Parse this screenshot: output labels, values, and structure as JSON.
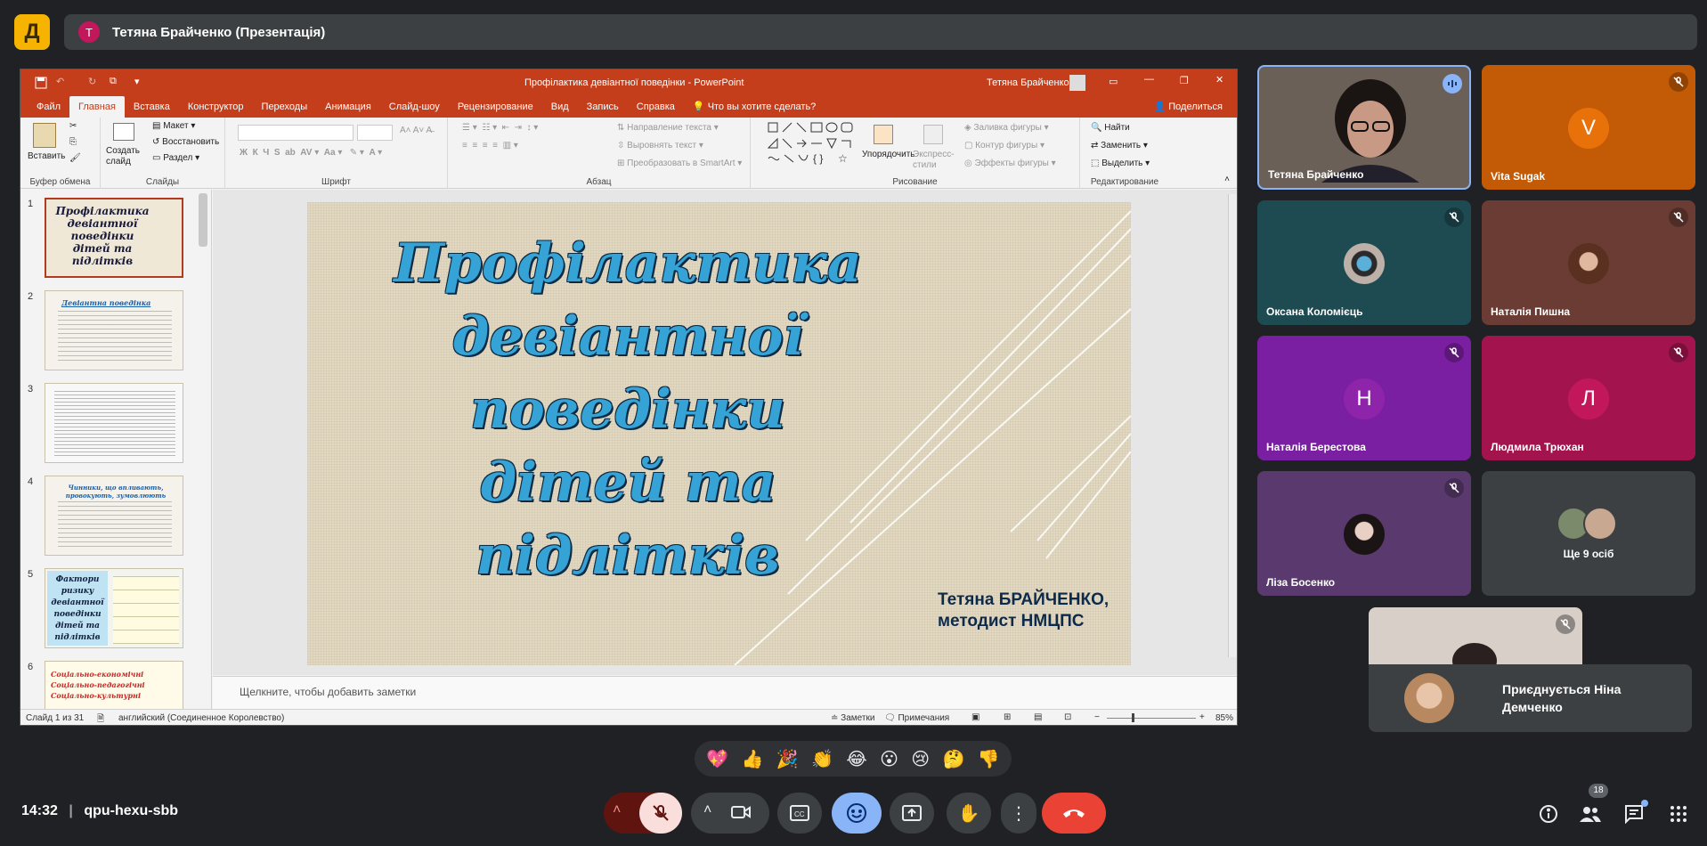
{
  "topbar": {
    "logo_glyph": "Д",
    "presenter_initial": "T",
    "presenter_label": "Тетяна Брайченко (Презентація)"
  },
  "ppt": {
    "window_title": "Профілактика девіантної поведінки  -  PowerPoint",
    "user_name": "Тетяна Брайченко",
    "tabs": [
      "Файл",
      "Главная",
      "Вставка",
      "Конструктор",
      "Переходы",
      "Анимация",
      "Слайд-шоу",
      "Рецензирование",
      "Вид",
      "Запись",
      "Справка"
    ],
    "tell_me": "Что вы хотите сделать?",
    "share": "Поделиться",
    "ribbon": {
      "paste": "Вставить",
      "clipboard_group": "Буфер обмена",
      "new_slide": "Создать слайд",
      "layout": "Макет",
      "reset": "Восстановить",
      "section": "Раздел",
      "slides_group": "Слайды",
      "font_group": "Шрифт",
      "text_direction": "Направление текста",
      "align_text": "Выровнять текст",
      "smartart": "Преобразовать в SmartArt",
      "paragraph_group": "Абзац",
      "arrange": "Упорядочить",
      "quick_styles": "Экспресс-стили",
      "shape_fill": "Заливка фигуры",
      "shape_outline": "Контур фигуры",
      "shape_effects": "Эффекты фигуры",
      "drawing_group": "Рисование",
      "find": "Найти",
      "replace": "Заменить",
      "select": "Выделить",
      "editing_group": "Редактирование"
    },
    "thumbnails": [
      {
        "num": "1",
        "text": "Профілактика девіантної поведінки дітей та підлітків"
      },
      {
        "num": "2",
        "text": "Девіантна поведінка"
      },
      {
        "num": "3",
        "text": ""
      },
      {
        "num": "4",
        "text": "Чинники, що впливають, провокують, зумовлюють"
      },
      {
        "num": "5",
        "text": "Фактори ризику девіантної поведінки дітей та підлітків"
      },
      {
        "num": "6",
        "text": "Соціально-економічні  Соціально-педагогічні  Соціально-культурні"
      }
    ],
    "slide": {
      "title": "Профілактика девіантної поведінки дітей та підлітків",
      "author": "Тетяна БРАЙЧЕНКО,\nметодист НМЦПС"
    },
    "notes_placeholder": "Щелкните, чтобы добавить заметки",
    "status": {
      "slide_count": "Слайд 1 из 31",
      "language": "английский (Соединенное Королевство)",
      "notes": "Заметки",
      "comments": "Примечания",
      "zoom": "85%"
    }
  },
  "participants": [
    {
      "name": "Тетяна Брайченко",
      "type": "video",
      "speaking": true,
      "bg": "#6b6058"
    },
    {
      "name": "Vita Sugak",
      "type": "letter",
      "letter": "V",
      "avatar_color": "#e8710a",
      "bg": "#c25a06"
    },
    {
      "name": "Оксана Коломієць",
      "type": "photo",
      "bg": "#1e4a52"
    },
    {
      "name": "Наталія Пишна",
      "type": "photo",
      "bg": "#6a3c34"
    },
    {
      "name": "Наталія Берестова",
      "type": "letter",
      "letter": "Н",
      "avatar_color": "#8e24aa",
      "bg": "#7b1fa2"
    },
    {
      "name": "Людмила Трюхан",
      "type": "letter",
      "letter": "Л",
      "avatar_color": "#c2185b",
      "bg": "#a3144f"
    },
    {
      "name": "Ліза Босенко",
      "type": "photo",
      "bg": "#5a3a6e"
    }
  ],
  "more_tile": {
    "label": "Ще 9 осіб"
  },
  "join_toast": {
    "text": "Приєднується Ніна Демченко"
  },
  "reactions": [
    "💖",
    "👍",
    "🎉",
    "👏",
    "😂",
    "😮",
    "😢",
    "🤔",
    "👎"
  ],
  "meeting": {
    "time": "14:32",
    "code": "qpu-hexu-sbb",
    "participant_count": "18"
  },
  "colors": {
    "accent": "#8ab4f8",
    "hangup": "#ea4335",
    "ppt_red": "#c43e1c"
  }
}
